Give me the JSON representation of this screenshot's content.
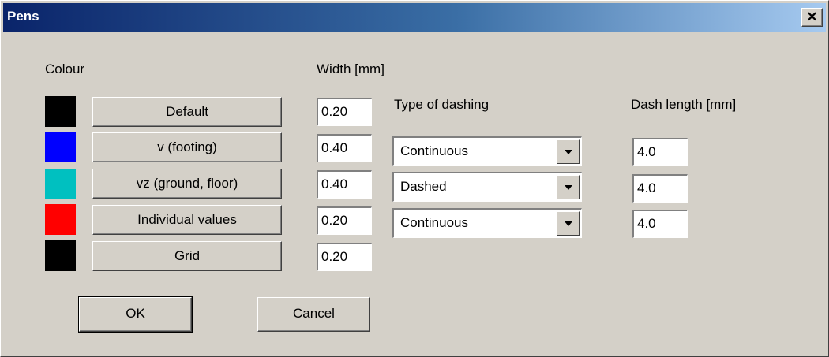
{
  "window": {
    "title": "Pens",
    "close_glyph": "✕"
  },
  "headers": {
    "colour": "Colour",
    "width": "Width [mm]",
    "type_of_dashing": "Type of dashing",
    "dash_length": "Dash length [mm]"
  },
  "pens": [
    {
      "label": "Default",
      "color": "#000000",
      "width": "0.20"
    },
    {
      "label": "v (footing)",
      "color": "#0000ff",
      "width": "0.40",
      "dashing": "Continuous",
      "dash_length": "4.0"
    },
    {
      "label": "vz (ground, floor)",
      "color": "#00c0c0",
      "width": "0.40",
      "dashing": "Dashed",
      "dash_length": "4.0"
    },
    {
      "label": "Individual values",
      "color": "#ff0000",
      "width": "0.20",
      "dashing": "Continuous",
      "dash_length": "4.0"
    },
    {
      "label": "Grid",
      "color": "#000000",
      "width": "0.20"
    }
  ],
  "buttons": {
    "ok": "OK",
    "cancel": "Cancel"
  }
}
